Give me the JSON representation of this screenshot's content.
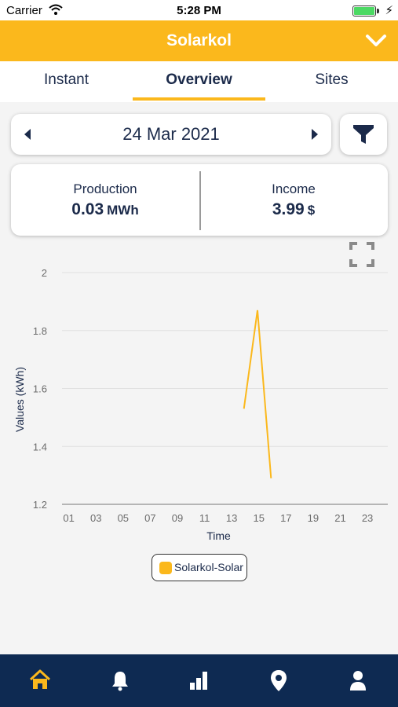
{
  "status_bar": {
    "carrier": "Carrier",
    "time": "5:28 PM"
  },
  "header": {
    "title": "Solarkol"
  },
  "tabs": [
    {
      "label": "Instant"
    },
    {
      "label": "Overview"
    },
    {
      "label": "Sites"
    }
  ],
  "date_selector": {
    "date": "24 Mar 2021"
  },
  "summary": {
    "production": {
      "label": "Production",
      "value": "0.03",
      "unit": "MWh"
    },
    "income": {
      "label": "Income",
      "value": "3.99",
      "unit": "$"
    }
  },
  "colors": {
    "accent": "#fbb81c",
    "nav_bg": "#0e2a52",
    "text": "#1b2a4a"
  },
  "icons": {
    "header": "chevron-down-icon",
    "filter": "filter-icon",
    "expand": "expand-icon",
    "nav": [
      "home-icon",
      "bell-icon",
      "bar-chart-icon",
      "map-pin-icon",
      "user-icon"
    ]
  },
  "chart_data": {
    "type": "line",
    "xlabel": "Time",
    "ylabel": "Values (kWh)",
    "x_ticks": [
      "01",
      "03",
      "05",
      "07",
      "09",
      "11",
      "13",
      "15",
      "17",
      "19",
      "21",
      "23"
    ],
    "y_ticks": [
      "1.2",
      "1.4",
      "1.6",
      "1.8",
      "2"
    ],
    "ylim": [
      1.2,
      2
    ],
    "xlim": [
      0,
      24
    ],
    "series": [
      {
        "name": "Solarkol-Solar",
        "color": "#fbb81c",
        "x": [
          13,
          14,
          15
        ],
        "y": [
          1.53,
          1.87,
          1.29
        ]
      }
    ],
    "legend": "bottom-center",
    "grid": true
  },
  "bottom_nav": {
    "active_index": 0
  }
}
